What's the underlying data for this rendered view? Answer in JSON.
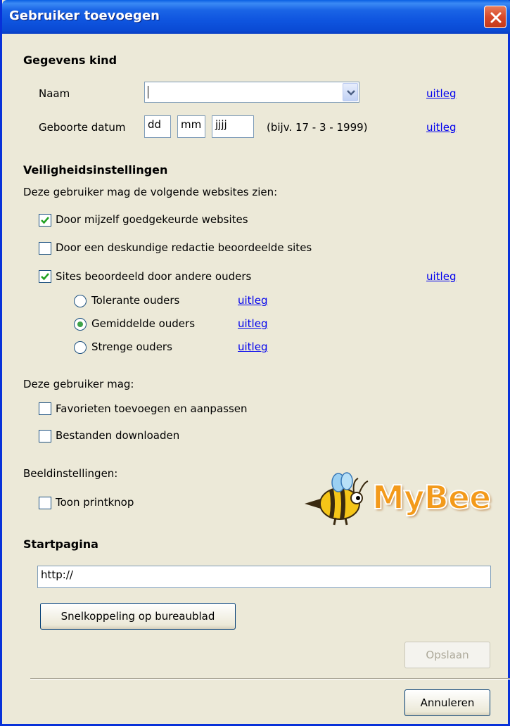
{
  "window": {
    "title": "Gebruiker toevoegen"
  },
  "child_section": {
    "heading": "Gegevens kind",
    "name_label": "Naam",
    "name_value": "",
    "name_link": "uitleg",
    "birthdate_label": "Geboorte datum",
    "day_value": "dd",
    "month_value": "mm",
    "year_value": "jjjj",
    "birthdate_hint": "(bijv. 17 - 3 - 1999)",
    "birthdate_link": "uitleg"
  },
  "security_section": {
    "heading": "Veiligheidsinstellingen",
    "intro": "Deze gebruiker mag de volgende websites zien:",
    "options": [
      {
        "label": "Door mijzelf goedgekeurde websites",
        "checked": true
      },
      {
        "label": "Door een deskundige redactie beoordeelde sites",
        "checked": false
      },
      {
        "label": "Sites beoordeeld door andere ouders",
        "checked": true,
        "link": "uitleg"
      }
    ],
    "parent_levels": [
      {
        "label": "Tolerante ouders",
        "selected": false,
        "link": "uitleg"
      },
      {
        "label": "Gemiddelde ouders",
        "selected": true,
        "link": "uitleg"
      },
      {
        "label": "Strenge ouders",
        "selected": false,
        "link": "uitleg"
      }
    ]
  },
  "permissions_section": {
    "intro": "Deze gebruiker mag:",
    "options": [
      {
        "label": "Favorieten toevoegen en aanpassen",
        "checked": false
      },
      {
        "label": "Bestanden downloaden",
        "checked": false
      }
    ]
  },
  "display_section": {
    "intro": "Beeldinstellingen:",
    "print_label": "Toon printknop",
    "print_checked": false
  },
  "logo": {
    "text": "MyBee",
    "color": "#f39a1b"
  },
  "startpage_section": {
    "heading": "Startpagina",
    "url_value": "http://",
    "shortcut_button": "Snelkoppeling op bureaublad"
  },
  "footer": {
    "save_button": "Opslaan",
    "save_enabled": false,
    "cancel_button": "Annuleren"
  },
  "colors": {
    "titlebar": "#0a4ad4",
    "dialog_background": "#ece9d8",
    "link": "#0000ee",
    "check_mark": "#21a121",
    "radio_dot": "#3ea34a"
  }
}
